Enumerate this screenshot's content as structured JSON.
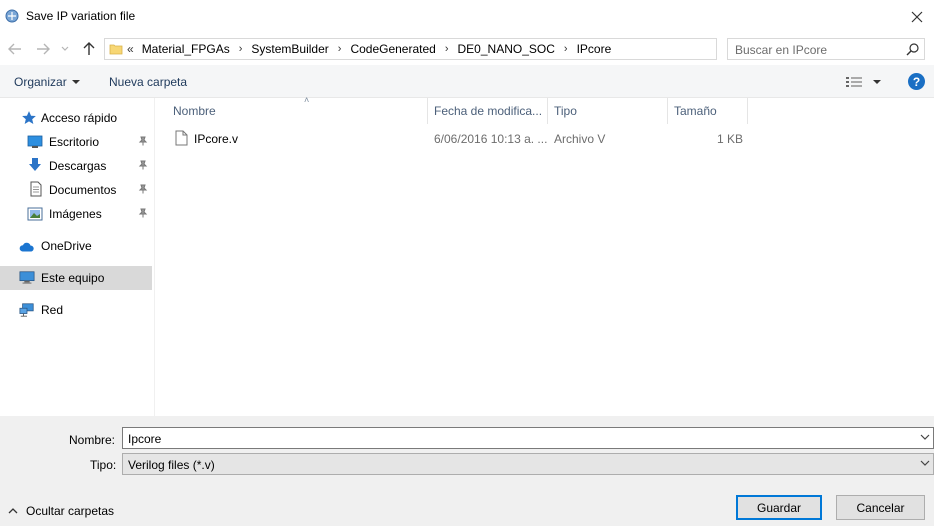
{
  "window": {
    "title": "Save IP variation file"
  },
  "address": {
    "lead": "«",
    "crumbs": [
      "Material_FPGAs",
      "SystemBuilder",
      "CodeGenerated",
      "DE0_NANO_SOC",
      "IPcore"
    ]
  },
  "search": {
    "placeholder": "Buscar en IPcore"
  },
  "toolbar": {
    "organize_label": "Organizar",
    "new_folder_label": "Nueva carpeta"
  },
  "sidebar": {
    "quick_access": "Acceso rápido",
    "items": [
      {
        "label": "Escritorio",
        "icon": "desktop-icon",
        "pinned": true
      },
      {
        "label": "Descargas",
        "icon": "download-icon",
        "pinned": true
      },
      {
        "label": "Documentos",
        "icon": "documents-icon",
        "pinned": true
      },
      {
        "label": "Imágenes",
        "icon": "pictures-icon",
        "pinned": true
      }
    ],
    "onedrive": "OneDrive",
    "this_pc": "Este equipo",
    "network": "Red"
  },
  "list": {
    "columns": [
      "Nombre",
      "Fecha de modifica...",
      "Tipo",
      "Tamaño"
    ],
    "rows": [
      {
        "name": "IPcore.v",
        "date": "6/06/2016 10:13 a. ...",
        "type": "Archivo V",
        "size": "1 KB"
      }
    ]
  },
  "form": {
    "name_label": "Nombre:",
    "name_value": "Ipcore",
    "type_label": "Tipo:",
    "type_value": "Verilog files (*.v)"
  },
  "footer": {
    "hide_folders": "Ocultar carpetas",
    "save_label": "Guardar",
    "cancel_label": "Cancelar"
  },
  "colors": {
    "accent": "#0078d7",
    "selected_bg": "#d9d9d9",
    "bottom_bg": "#f0f0f0",
    "help": "#1a6fc4"
  }
}
